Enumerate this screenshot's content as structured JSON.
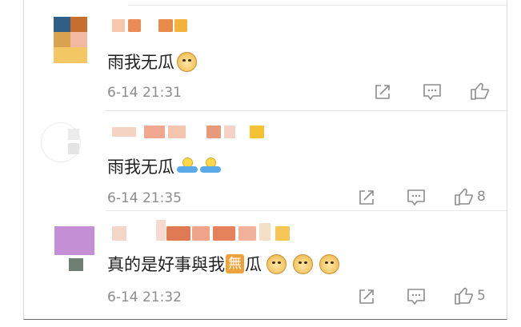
{
  "comments": [
    {
      "text": "雨我无瓜",
      "time": "6-14 21:31",
      "like_count": ""
    },
    {
      "text": "雨我无瓜",
      "time": "6-14 21:35",
      "like_count": "8"
    },
    {
      "text_before": "真的是好事與我",
      "badge": "無",
      "text_after": "瓜",
      "time": "6-14 21:32",
      "like_count": "5"
    }
  ],
  "icons": {
    "share": "share-icon",
    "reply": "comment-icon",
    "like": "thumbs-up-icon",
    "doge": "doge-emoji",
    "shrug": "shrug-emoji"
  },
  "colors": {
    "meta_gray": "#8c8c8c",
    "badge_orange": "#f0a23a"
  }
}
